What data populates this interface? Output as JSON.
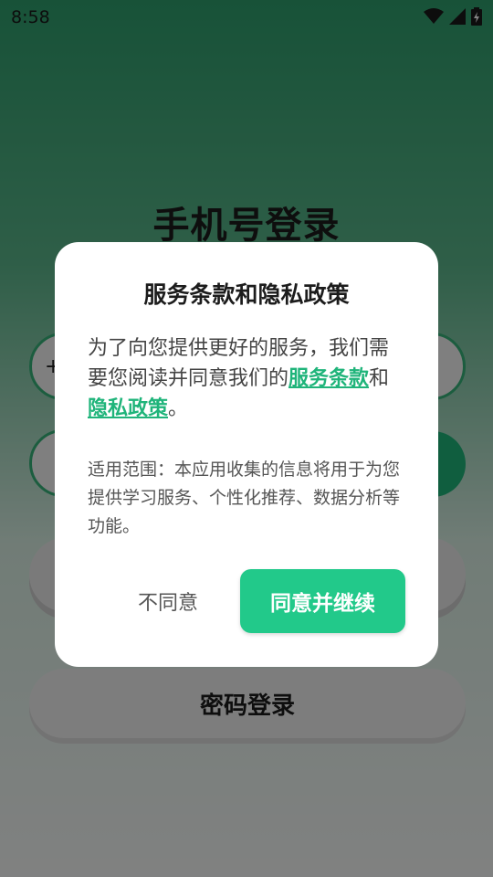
{
  "status_bar": {
    "time": "8:58"
  },
  "page": {
    "title": "手机号登录",
    "country_code": "+",
    "code_placeholder": "",
    "password_login_label": "密码登录"
  },
  "dialog": {
    "title": "服务条款和隐私政策",
    "intro": "为了向您提供更好的服务，我们需要您阅读并同意我们的",
    "terms_link": "服务条款",
    "conjunction": "和",
    "privacy_link": "隐私政策",
    "period": "。",
    "scope_text": "适用范围：本应用收集的信息将用于为您提供学习服务、个性化推荐、数据分析等功能。",
    "disagree_label": "不同意",
    "agree_label": "同意并继续"
  },
  "colors": {
    "accent": "#22c98a",
    "link": "#1fb47a",
    "header_green": "#2e9e6c"
  }
}
